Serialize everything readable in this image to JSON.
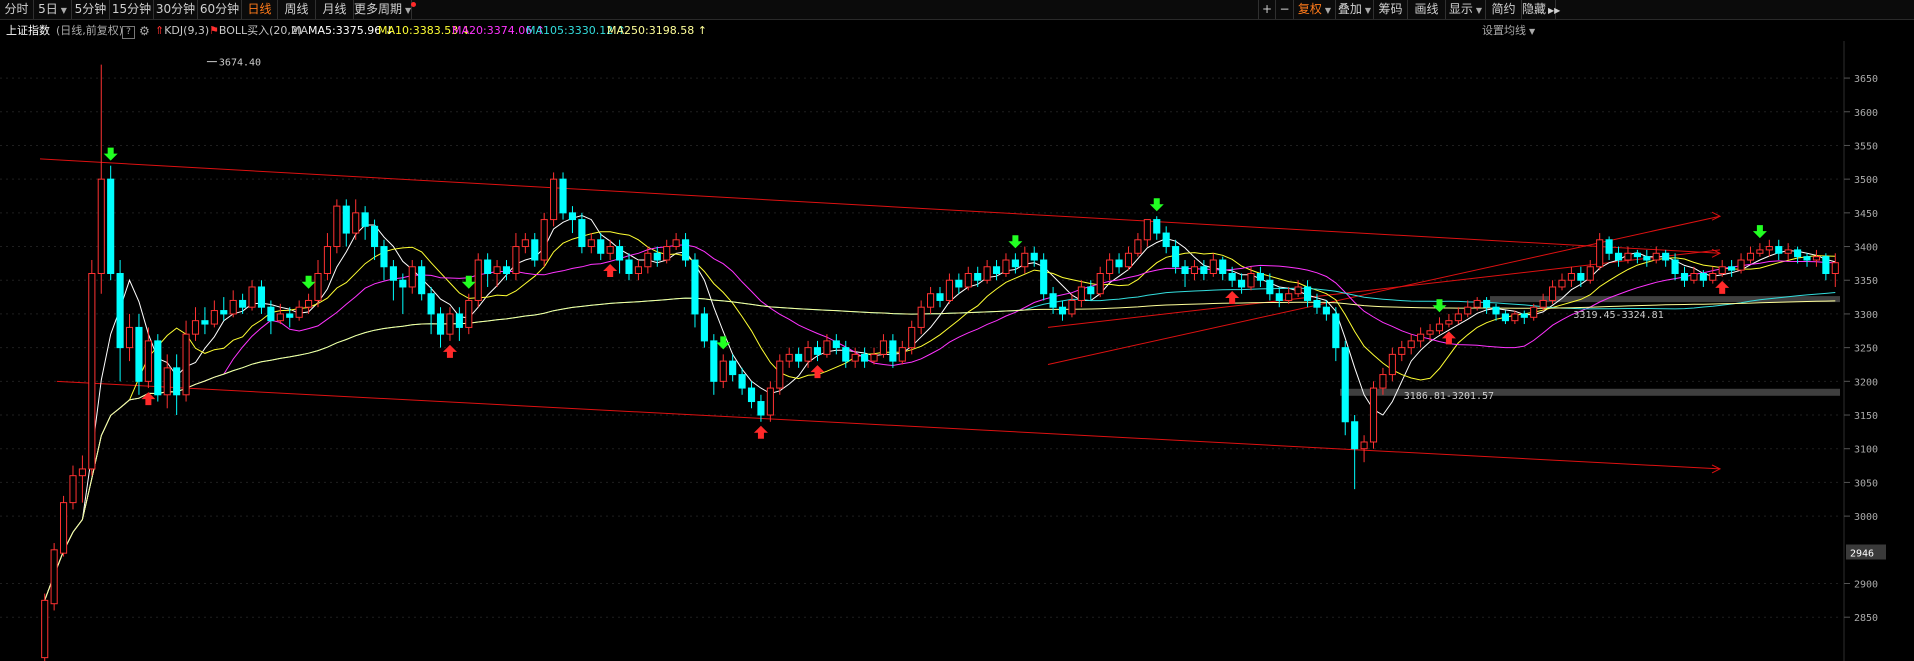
{
  "toolbar": {
    "left_tabs": [
      {
        "label": "分时",
        "active": false,
        "caret": false
      },
      {
        "label": "5日",
        "active": false,
        "caret": true
      },
      {
        "label": "5分钟",
        "active": false,
        "caret": false
      },
      {
        "label": "15分钟",
        "active": false,
        "caret": false
      },
      {
        "label": "30分钟",
        "active": false,
        "caret": false
      },
      {
        "label": "60分钟",
        "active": false,
        "caret": false
      },
      {
        "label": "日线",
        "active": true,
        "caret": false
      },
      {
        "label": "周线",
        "active": false,
        "caret": false
      },
      {
        "label": "月线",
        "active": false,
        "caret": false
      },
      {
        "label": "更多周期",
        "active": false,
        "caret": true
      }
    ],
    "plus": "+",
    "minus": "−",
    "right_tabs": [
      {
        "label": "复权",
        "active": true,
        "caret": true
      },
      {
        "label": "叠加",
        "active": false,
        "caret": true
      },
      {
        "label": "筹码",
        "active": false,
        "caret": false
      },
      {
        "label": "画线",
        "active": false,
        "caret": false
      },
      {
        "label": "显示",
        "active": false,
        "caret": true
      },
      {
        "label": "简约",
        "active": false,
        "caret": false
      },
      {
        "label": "隐藏",
        "active": false,
        "caret": false
      }
    ],
    "hide_arrows": "▶▶"
  },
  "infobar": {
    "index_name": "上证指数",
    "period_label": "(日线,前复权)",
    "help": "?",
    "kdj_label": "KDJ(9,3)",
    "boll_label": "BOLL买入(20,2)",
    "ma_label": "MA",
    "ma": [
      {
        "label": "MA5:3375.96",
        "arrow": "↓",
        "color": "#ffffff"
      },
      {
        "label": "MA10:3383.53",
        "arrow": "↓",
        "color": "#ffff33"
      },
      {
        "label": "MA20:3374.06",
        "arrow": "↑",
        "color": "#ff33ff"
      },
      {
        "label": "MA105:3330.12",
        "arrow": "↑",
        "color": "#33dddd"
      },
      {
        "label": "MA250:3198.58",
        "arrow": "↑",
        "color": "#ffff99"
      }
    ],
    "settings": "设置均线"
  },
  "chart_data": {
    "type": "candlestick",
    "y_ticks": [
      3650,
      3600,
      3550,
      3500,
      3450,
      3400,
      3350,
      3300,
      3250,
      3200,
      3150,
      3100,
      3050,
      3000,
      2900,
      2850
    ],
    "ylim": [
      2785,
      3705
    ],
    "current_price": "2946",
    "annotations": [
      {
        "text": "3674.40",
        "x": 17,
        "y": 3674.4
      },
      {
        "text": "3186.81-3201.57",
        "x": 144,
        "y": 3180
      },
      {
        "text": "3319.45-3324.81",
        "x": 162,
        "y": 3300
      }
    ],
    "colors": {
      "up": "#ff3232",
      "down": "#00ffff",
      "ma5": "#ffffff",
      "ma10": "#ffff33",
      "ma20": "#ff33ff",
      "ma105": "#33dddd",
      "ma250": "#ffff99",
      "trend": "#dd1111",
      "grid": "#1f1f1f",
      "buy": "#ff2a2a",
      "sell": "#22ff22"
    },
    "candles": [
      [
        2790,
        2875,
        2770,
        2885
      ],
      [
        2870,
        2950,
        2860,
        2960
      ],
      [
        2945,
        3020,
        2940,
        3030
      ],
      [
        3020,
        3060,
        3010,
        3075
      ],
      [
        3060,
        3070,
        3020,
        3090
      ],
      [
        3070,
        3360,
        3060,
        3380
      ],
      [
        3360,
        3500,
        3330,
        3670
      ],
      [
        3500,
        3360,
        3350,
        3520
      ],
      [
        3360,
        3250,
        3200,
        3380
      ],
      [
        3250,
        3280,
        3230,
        3300
      ],
      [
        3280,
        3200,
        3180,
        3300
      ],
      [
        3200,
        3260,
        3190,
        3280
      ],
      [
        3260,
        3180,
        3170,
        3270
      ],
      [
        3180,
        3220,
        3160,
        3240
      ],
      [
        3220,
        3180,
        3150,
        3240
      ],
      [
        3180,
        3270,
        3170,
        3290
      ],
      [
        3270,
        3290,
        3260,
        3310
      ],
      [
        3290,
        3285,
        3270,
        3310
      ],
      [
        3285,
        3305,
        3280,
        3320
      ],
      [
        3305,
        3300,
        3290,
        3325
      ],
      [
        3300,
        3320,
        3295,
        3335
      ],
      [
        3320,
        3310,
        3300,
        3330
      ],
      [
        3310,
        3340,
        3305,
        3350
      ],
      [
        3340,
        3310,
        3300,
        3350
      ],
      [
        3310,
        3290,
        3270,
        3320
      ],
      [
        3290,
        3300,
        3285,
        3315
      ],
      [
        3300,
        3295,
        3280,
        3310
      ],
      [
        3295,
        3310,
        3290,
        3320
      ],
      [
        3310,
        3320,
        3300,
        3330
      ],
      [
        3320,
        3360,
        3310,
        3380
      ],
      [
        3360,
        3400,
        3350,
        3420
      ],
      [
        3400,
        3460,
        3390,
        3470
      ],
      [
        3460,
        3420,
        3400,
        3470
      ],
      [
        3420,
        3450,
        3410,
        3470
      ],
      [
        3450,
        3430,
        3410,
        3460
      ],
      [
        3430,
        3400,
        3380,
        3440
      ],
      [
        3400,
        3370,
        3350,
        3410
      ],
      [
        3370,
        3350,
        3320,
        3380
      ],
      [
        3350,
        3340,
        3300,
        3360
      ],
      [
        3340,
        3370,
        3330,
        3380
      ],
      [
        3370,
        3330,
        3320,
        3380
      ],
      [
        3330,
        3300,
        3270,
        3340
      ],
      [
        3300,
        3270,
        3250,
        3310
      ],
      [
        3270,
        3300,
        3260,
        3310
      ],
      [
        3300,
        3280,
        3260,
        3310
      ],
      [
        3280,
        3320,
        3270,
        3330
      ],
      [
        3320,
        3380,
        3310,
        3390
      ],
      [
        3380,
        3360,
        3340,
        3390
      ],
      [
        3360,
        3370,
        3340,
        3380
      ],
      [
        3370,
        3360,
        3350,
        3380
      ],
      [
        3360,
        3400,
        3350,
        3420
      ],
      [
        3400,
        3410,
        3390,
        3420
      ],
      [
        3410,
        3380,
        3370,
        3420
      ],
      [
        3380,
        3440,
        3370,
        3450
      ],
      [
        3440,
        3500,
        3430,
        3510
      ],
      [
        3500,
        3450,
        3440,
        3510
      ],
      [
        3450,
        3440,
        3420,
        3460
      ],
      [
        3440,
        3400,
        3390,
        3450
      ],
      [
        3400,
        3410,
        3390,
        3420
      ],
      [
        3410,
        3390,
        3380,
        3420
      ],
      [
        3390,
        3400,
        3380,
        3410
      ],
      [
        3400,
        3380,
        3360,
        3410
      ],
      [
        3380,
        3360,
        3350,
        3390
      ],
      [
        3360,
        3370,
        3350,
        3380
      ],
      [
        3370,
        3390,
        3360,
        3400
      ],
      [
        3390,
        3380,
        3370,
        3400
      ],
      [
        3380,
        3400,
        3375,
        3410
      ],
      [
        3400,
        3410,
        3395,
        3420
      ],
      [
        3410,
        3380,
        3370,
        3420
      ],
      [
        3380,
        3300,
        3280,
        3390
      ],
      [
        3300,
        3260,
        3250,
        3310
      ],
      [
        3260,
        3200,
        3180,
        3270
      ],
      [
        3200,
        3230,
        3190,
        3240
      ],
      [
        3230,
        3210,
        3200,
        3240
      ],
      [
        3210,
        3190,
        3180,
        3220
      ],
      [
        3190,
        3170,
        3160,
        3200
      ],
      [
        3170,
        3150,
        3140,
        3180
      ],
      [
        3150,
        3190,
        3140,
        3200
      ],
      [
        3190,
        3230,
        3180,
        3240
      ],
      [
        3230,
        3240,
        3220,
        3250
      ],
      [
        3240,
        3230,
        3220,
        3250
      ],
      [
        3230,
        3250,
        3220,
        3260
      ],
      [
        3250,
        3240,
        3230,
        3260
      ],
      [
        3240,
        3260,
        3235,
        3270
      ],
      [
        3260,
        3250,
        3240,
        3270
      ],
      [
        3250,
        3230,
        3220,
        3260
      ],
      [
        3230,
        3240,
        3220,
        3250
      ],
      [
        3240,
        3230,
        3220,
        3250
      ],
      [
        3230,
        3240,
        3225,
        3250
      ],
      [
        3240,
        3260,
        3235,
        3270
      ],
      [
        3260,
        3230,
        3220,
        3270
      ],
      [
        3230,
        3250,
        3225,
        3260
      ],
      [
        3250,
        3280,
        3240,
        3290
      ],
      [
        3280,
        3310,
        3270,
        3320
      ],
      [
        3310,
        3330,
        3300,
        3340
      ],
      [
        3330,
        3320,
        3310,
        3340
      ],
      [
        3320,
        3350,
        3315,
        3360
      ],
      [
        3350,
        3340,
        3330,
        3360
      ],
      [
        3340,
        3360,
        3335,
        3370
      ],
      [
        3360,
        3350,
        3340,
        3370
      ],
      [
        3350,
        3370,
        3345,
        3380
      ],
      [
        3370,
        3360,
        3350,
        3380
      ],
      [
        3360,
        3380,
        3355,
        3390
      ],
      [
        3380,
        3370,
        3360,
        3390
      ],
      [
        3370,
        3390,
        3360,
        3400
      ],
      [
        3390,
        3380,
        3370,
        3400
      ],
      [
        3380,
        3330,
        3320,
        3390
      ],
      [
        3330,
        3310,
        3300,
        3340
      ],
      [
        3310,
        3300,
        3290,
        3320
      ],
      [
        3300,
        3320,
        3295,
        3330
      ],
      [
        3320,
        3340,
        3310,
        3350
      ],
      [
        3340,
        3330,
        3320,
        3350
      ],
      [
        3330,
        3360,
        3325,
        3370
      ],
      [
        3360,
        3380,
        3350,
        3390
      ],
      [
        3380,
        3370,
        3360,
        3390
      ],
      [
        3370,
        3390,
        3365,
        3400
      ],
      [
        3390,
        3410,
        3385,
        3420
      ],
      [
        3410,
        3440,
        3400,
        3440
      ],
      [
        3440,
        3420,
        3410,
        3445
      ],
      [
        3420,
        3400,
        3390,
        3430
      ],
      [
        3400,
        3370,
        3360,
        3410
      ],
      [
        3370,
        3360,
        3340,
        3380
      ],
      [
        3360,
        3370,
        3350,
        3380
      ],
      [
        3370,
        3360,
        3350,
        3380
      ],
      [
        3360,
        3380,
        3355,
        3390
      ],
      [
        3380,
        3360,
        3350,
        3385
      ],
      [
        3360,
        3350,
        3340,
        3370
      ],
      [
        3350,
        3340,
        3330,
        3360
      ],
      [
        3340,
        3360,
        3335,
        3370
      ],
      [
        3360,
        3350,
        3340,
        3370
      ],
      [
        3350,
        3330,
        3320,
        3360
      ],
      [
        3330,
        3320,
        3310,
        3340
      ],
      [
        3320,
        3330,
        3315,
        3340
      ],
      [
        3330,
        3340,
        3325,
        3350
      ],
      [
        3340,
        3320,
        3310,
        3350
      ],
      [
        3320,
        3310,
        3300,
        3330
      ],
      [
        3310,
        3300,
        3290,
        3320
      ],
      [
        3300,
        3250,
        3230,
        3310
      ],
      [
        3250,
        3140,
        3120,
        3260
      ],
      [
        3140,
        3100,
        3040,
        3150
      ],
      [
        3100,
        3110,
        3080,
        3120
      ],
      [
        3110,
        3190,
        3100,
        3200
      ],
      [
        3190,
        3210,
        3180,
        3220
      ],
      [
        3210,
        3240,
        3200,
        3250
      ],
      [
        3240,
        3250,
        3230,
        3260
      ],
      [
        3250,
        3260,
        3240,
        3270
      ],
      [
        3260,
        3270,
        3250,
        3280
      ],
      [
        3270,
        3275,
        3260,
        3285
      ],
      [
        3275,
        3285,
        3270,
        3295
      ],
      [
        3285,
        3290,
        3280,
        3300
      ],
      [
        3290,
        3300,
        3285,
        3310
      ],
      [
        3300,
        3310,
        3295,
        3320
      ],
      [
        3310,
        3320,
        3305,
        3325
      ],
      [
        3320,
        3310,
        3300,
        3325
      ],
      [
        3310,
        3300,
        3290,
        3315
      ],
      [
        3300,
        3290,
        3285,
        3305
      ],
      [
        3290,
        3300,
        3285,
        3305
      ],
      [
        3300,
        3295,
        3285,
        3305
      ],
      [
        3295,
        3310,
        3290,
        3315
      ],
      [
        3310,
        3320,
        3305,
        3330
      ],
      [
        3320,
        3340,
        3315,
        3350
      ],
      [
        3340,
        3350,
        3335,
        3360
      ],
      [
        3350,
        3360,
        3340,
        3370
      ],
      [
        3360,
        3350,
        3340,
        3370
      ],
      [
        3350,
        3370,
        3345,
        3380
      ],
      [
        3370,
        3410,
        3365,
        3420
      ],
      [
        3410,
        3390,
        3380,
        3415
      ],
      [
        3390,
        3380,
        3370,
        3400
      ],
      [
        3380,
        3390,
        3375,
        3400
      ],
      [
        3390,
        3385,
        3375,
        3395
      ],
      [
        3385,
        3380,
        3370,
        3395
      ],
      [
        3380,
        3390,
        3375,
        3400
      ],
      [
        3390,
        3380,
        3370,
        3395
      ],
      [
        3380,
        3360,
        3350,
        3390
      ],
      [
        3360,
        3350,
        3340,
        3370
      ],
      [
        3350,
        3360,
        3345,
        3370
      ],
      [
        3360,
        3350,
        3340,
        3365
      ],
      [
        3350,
        3360,
        3345,
        3370
      ],
      [
        3360,
        3370,
        3355,
        3380
      ],
      [
        3370,
        3365,
        3355,
        3380
      ],
      [
        3365,
        3380,
        3360,
        3390
      ],
      [
        3380,
        3390,
        3375,
        3400
      ],
      [
        3390,
        3395,
        3385,
        3405
      ],
      [
        3395,
        3400,
        3385,
        3410
      ],
      [
        3400,
        3390,
        3380,
        3410
      ],
      [
        3390,
        3395,
        3380,
        3405
      ],
      [
        3395,
        3385,
        3375,
        3400
      ],
      [
        3385,
        3380,
        3370,
        3390
      ],
      [
        3380,
        3385,
        3370,
        3395
      ],
      [
        3385,
        3360,
        3350,
        3390
      ],
      [
        3360,
        3376,
        3340,
        3390
      ]
    ]
  }
}
